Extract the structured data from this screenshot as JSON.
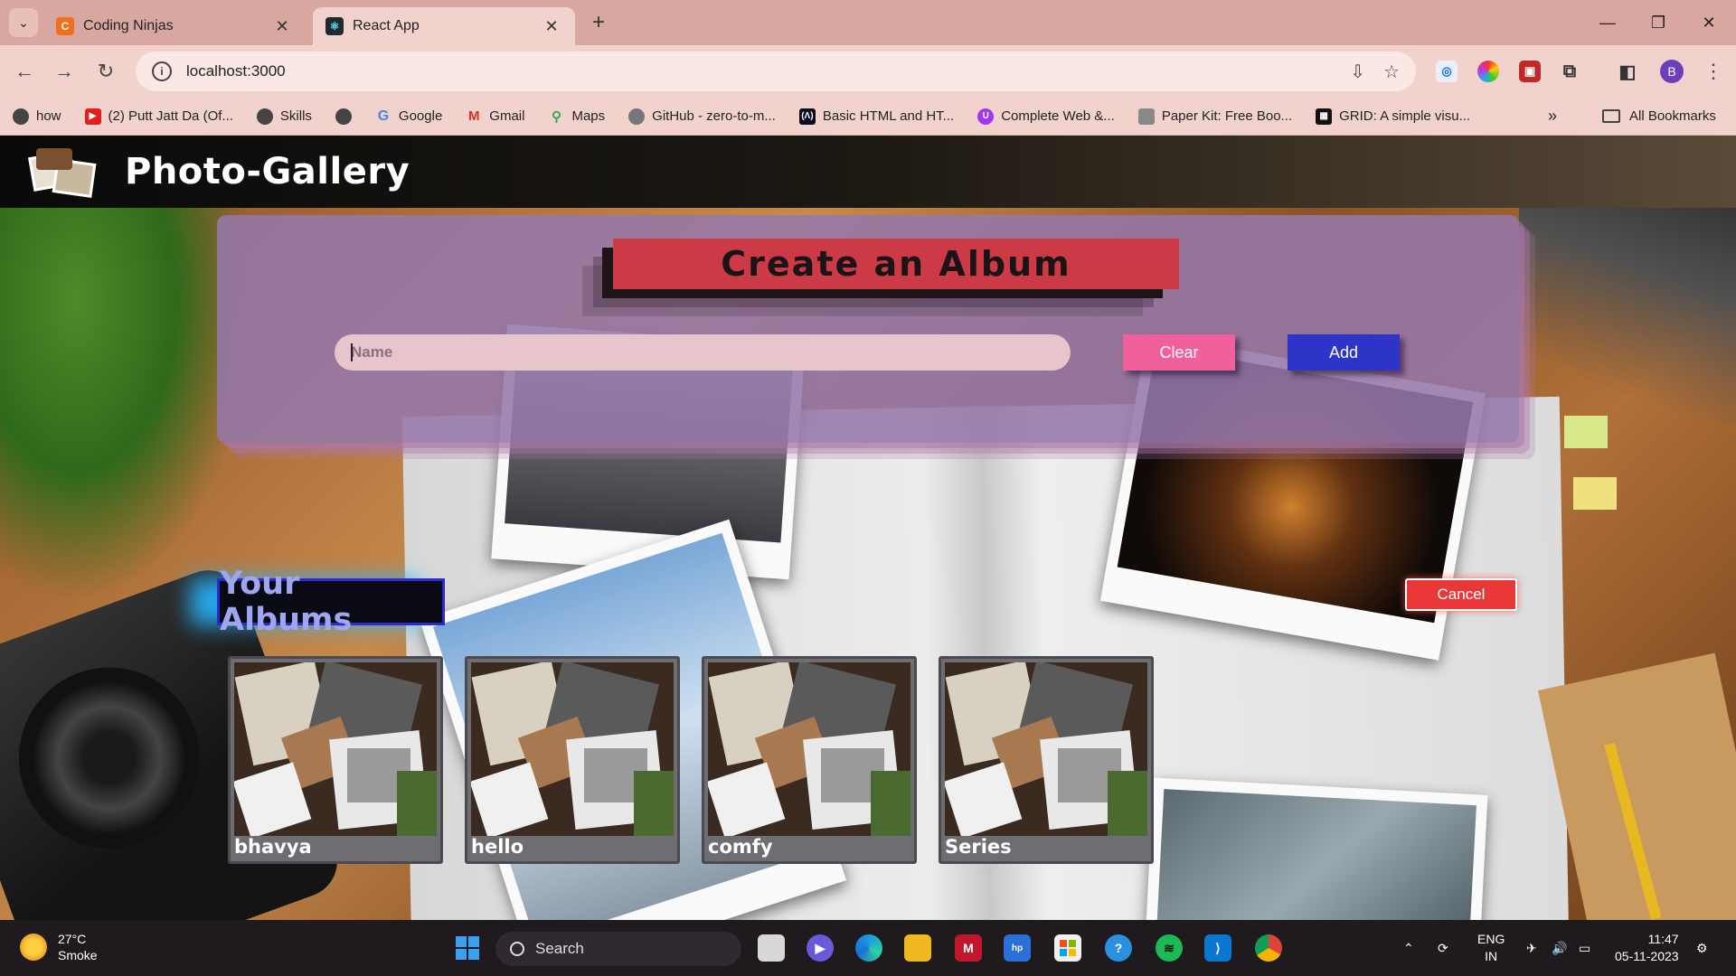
{
  "browser": {
    "tabs": [
      {
        "title": "Coding Ninjas",
        "favicon_color": "#f07020"
      },
      {
        "title": "React App",
        "favicon_color": "#1e2a30"
      }
    ],
    "url": "localhost:3000",
    "bookmarks": [
      {
        "label": "how",
        "icon": "globe-icon",
        "color": "#444444"
      },
      {
        "label": "(2) Putt Jatt Da (Of...",
        "icon": "youtube-icon",
        "color": "#e02020"
      },
      {
        "label": "Skills",
        "icon": "globe-icon",
        "color": "#444444"
      },
      {
        "label": "",
        "icon": "globe-icon",
        "color": "#444444"
      },
      {
        "label": "Google",
        "icon": "google-icon",
        "color": "#4285f4"
      },
      {
        "label": "Gmail",
        "icon": "gmail-icon",
        "color": "#d93025"
      },
      {
        "label": "Maps",
        "icon": "maps-icon",
        "color": "#34a853"
      },
      {
        "label": "GitHub - zero-to-m...",
        "icon": "github-icon",
        "color": "#222222"
      },
      {
        "label": "Basic HTML and HT...",
        "icon": "freecodecamp-icon",
        "color": "#0a0a23"
      },
      {
        "label": "Complete Web &...",
        "icon": "udemy-icon",
        "color": "#a435f0"
      },
      {
        "label": "Paper Kit: Free Boo...",
        "icon": "paperkit-icon",
        "color": "#666666"
      },
      {
        "label": "GRID: A simple visu...",
        "icon": "grid-icon",
        "color": "#111111"
      }
    ],
    "all_bookmarks_label": "All Bookmarks",
    "more_label": "»",
    "avatar_initial": "B"
  },
  "app": {
    "title": "Photo-Gallery",
    "create": {
      "heading": "Create an Album",
      "input_placeholder": "Name",
      "clear_label": "Clear",
      "add_label": "Add"
    },
    "albums_heading": "Your Albums",
    "cancel_label": "Cancel",
    "albums": [
      {
        "name": "bhavya"
      },
      {
        "name": "hello"
      },
      {
        "name": "comfy"
      },
      {
        "name": "Series"
      }
    ]
  },
  "taskbar": {
    "weather_temp": "27°C",
    "weather_desc": "Smoke",
    "search_label": "Search",
    "lang_line1": "ENG",
    "lang_line2": "IN",
    "time": "11:47",
    "date": "05-11-2023"
  }
}
